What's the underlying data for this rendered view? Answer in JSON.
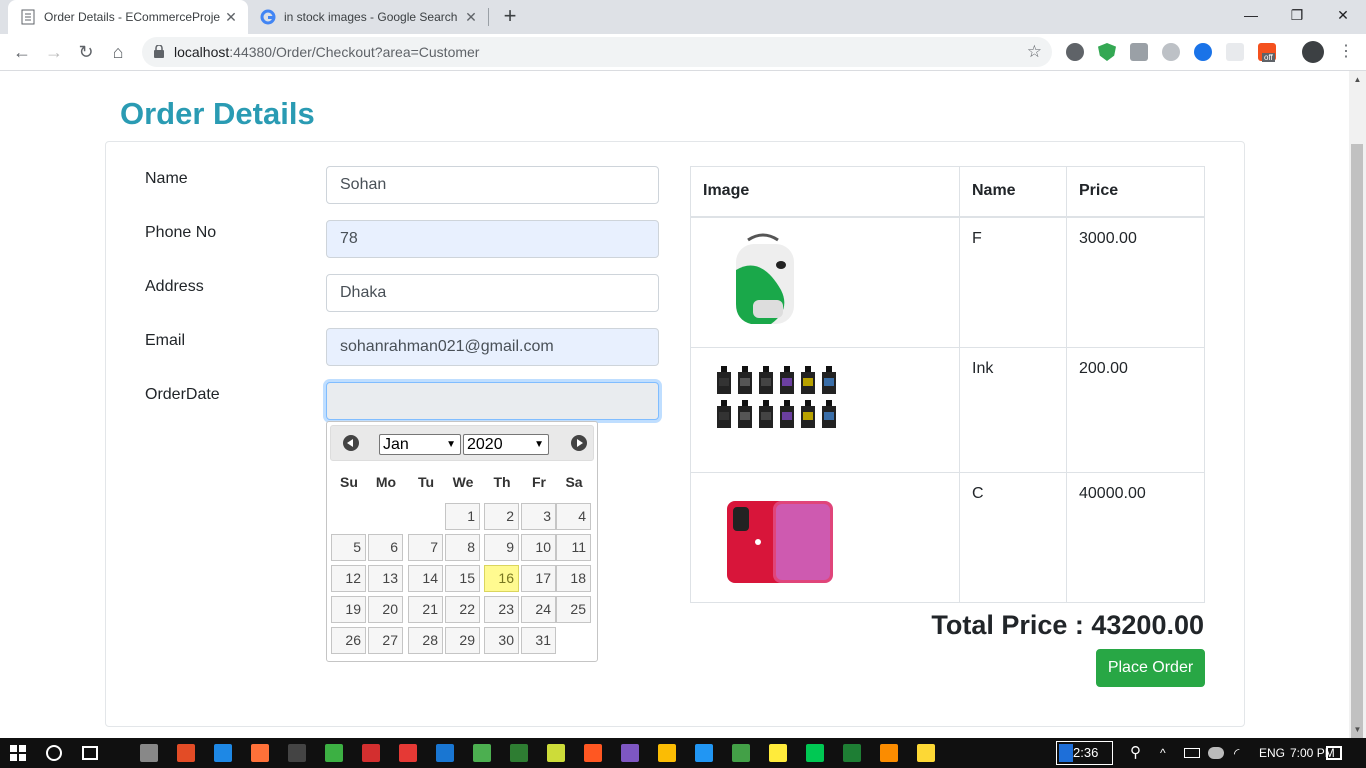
{
  "browser": {
    "tabs": [
      {
        "title": "Order Details - ECommerceProje",
        "active": true
      },
      {
        "title": "in stock images - Google Search",
        "active": false
      }
    ],
    "url_host": "localhost",
    "url_rest": ":44380/Order/Checkout?area=Customer",
    "extension_badge": "off"
  },
  "page": {
    "title": "Order Details",
    "form": {
      "name_label": "Name",
      "name_value": "Sohan",
      "phone_label": "Phone No",
      "phone_value": "78",
      "address_label": "Address",
      "address_value": "Dhaka",
      "email_label": "Email",
      "email_value": "sohanrahman021@gmail.com",
      "orderdate_label": "OrderDate",
      "orderdate_value": ""
    },
    "datepicker": {
      "month": "Jan",
      "year": "2020",
      "weekdays": [
        "Su",
        "Mo",
        "Tu",
        "We",
        "Th",
        "Fr",
        "Sa"
      ],
      "days": [
        "1",
        "2",
        "3",
        "4",
        "5",
        "6",
        "7",
        "8",
        "9",
        "10",
        "11",
        "12",
        "13",
        "14",
        "15",
        "16",
        "17",
        "18",
        "19",
        "20",
        "21",
        "22",
        "23",
        "24",
        "25",
        "26",
        "27",
        "28",
        "29",
        "30",
        "31"
      ],
      "today": "16"
    },
    "cart": {
      "headers": {
        "image": "Image",
        "name": "Name",
        "price": "Price"
      },
      "items": [
        {
          "name": "F",
          "price": "3000.00",
          "image": "backpack"
        },
        {
          "name": "Ink",
          "price": "200.00",
          "image": "ink-tanks"
        },
        {
          "name": "C",
          "price": "40000.00",
          "image": "red-phone"
        }
      ]
    },
    "total_text": "Total Price : 43200.00",
    "place_order_label": "Place Order"
  },
  "taskbar": {
    "clock_box": "2:36",
    "time": "7:00 PM"
  },
  "colors": {
    "title": "#2a9bb3",
    "success": "#28a745",
    "today": "#fffa90"
  }
}
